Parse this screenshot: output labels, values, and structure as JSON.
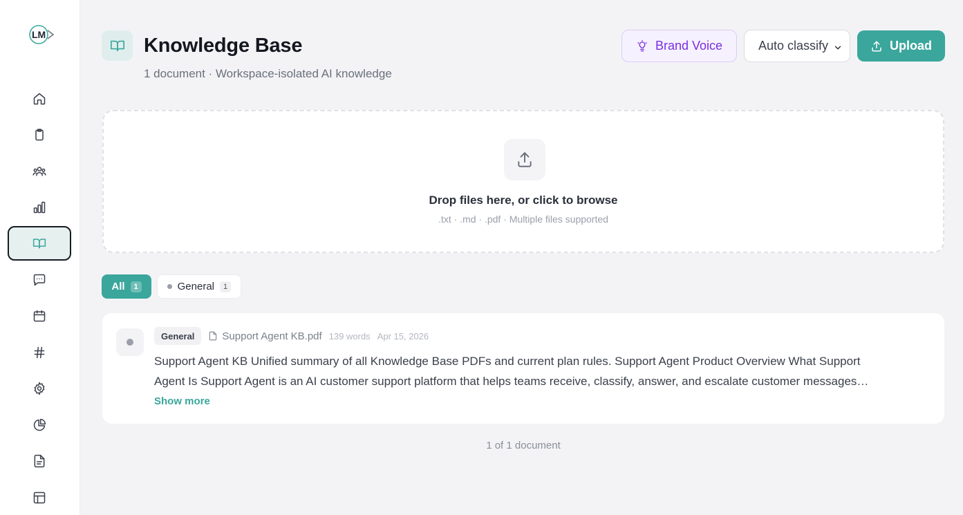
{
  "header": {
    "title": "Knowledge Base",
    "subtitle": "1 document · Workspace-isolated AI knowledge",
    "brand_voice_label": "Brand Voice",
    "classify_value": "Auto classify",
    "upload_label": "Upload"
  },
  "sidebar": {
    "items": [
      {
        "icon": "home-icon"
      },
      {
        "icon": "clipboard-icon"
      },
      {
        "icon": "users-icon"
      },
      {
        "icon": "bar-chart-icon"
      },
      {
        "icon": "book-open-icon",
        "active": true
      },
      {
        "icon": "message-icon"
      },
      {
        "icon": "calendar-icon"
      },
      {
        "icon": "hash-icon"
      },
      {
        "icon": "gear-icon"
      },
      {
        "icon": "pie-chart-icon"
      },
      {
        "icon": "file-text-icon"
      },
      {
        "icon": "layout-icon"
      }
    ]
  },
  "dropzone": {
    "title": "Drop files here, or click to browse",
    "subtitle": ".txt · .md · .pdf  · Multiple files supported"
  },
  "filters": {
    "all_label": "All",
    "all_count": "1",
    "general_label": "General",
    "general_count": "1"
  },
  "document": {
    "tag": "General",
    "file_name": "Support Agent KB.pdf",
    "words": "139 words",
    "date": "Apr 15, 2026",
    "preview": "Support Agent KB Unified summary of all Knowledge Base PDFs and current plan rules. Support Agent Product Overview What Support Agent Is Support Agent is an AI customer support platform that helps teams receive, classify, answer, and escalate customer messages…",
    "show_more": "Show more"
  },
  "pagination": "1 of 1 document",
  "colors": {
    "accent": "#3aa69c",
    "brand_voice": "#7a2fe0",
    "background": "#f3f3f5"
  }
}
